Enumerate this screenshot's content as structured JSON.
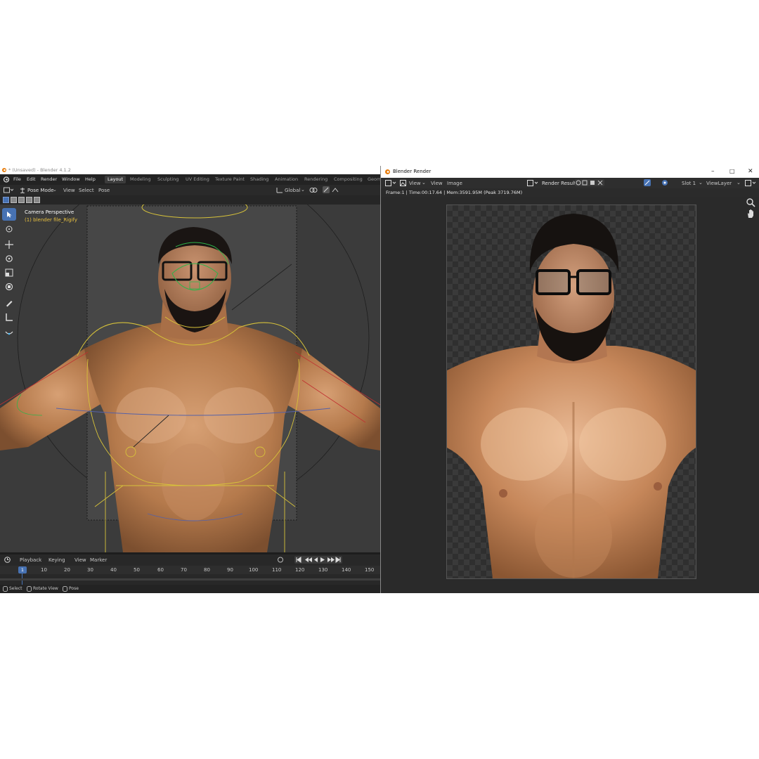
{
  "main_window": {
    "title": "* (Unsaved) - Blender 4.1.2",
    "menu": [
      "File",
      "Edit",
      "Render",
      "Window",
      "Help"
    ],
    "workspaces": [
      "Layout",
      "Modeling",
      "Sculpting",
      "UV Editing",
      "Texture Paint",
      "Shading",
      "Animation",
      "Rendering",
      "Compositing",
      "Geom"
    ],
    "active_workspace": "Layout",
    "header": {
      "mode": "Pose Mode",
      "menus": [
        "View",
        "Select",
        "Pose"
      ],
      "orientation": "Global"
    },
    "viewport": {
      "camera_label": "Camera Perspective",
      "object_label": "(1) blender file_Rigify"
    },
    "tools": [
      "select-box-tool",
      "cursor-tool",
      "move-tool",
      "rotate-tool",
      "scale-tool",
      "transform-tool",
      "annotate-tool",
      "measure-tool",
      "bend-tool"
    ],
    "timeline": {
      "menus": [
        "Playback",
        "Keying",
        "View",
        "Marker"
      ],
      "current_frame": "1",
      "ticks": [
        "10",
        "20",
        "30",
        "40",
        "50",
        "60",
        "70",
        "80",
        "90",
        "100",
        "110",
        "120",
        "130",
        "140",
        "150"
      ]
    },
    "status": [
      "Select",
      "Rotate View",
      "Pose"
    ]
  },
  "render_window": {
    "title": "Blender Render",
    "menus": [
      "View",
      "View",
      "Image"
    ],
    "image_name": "Render Result",
    "slot": "Slot 1",
    "view_layer": "ViewLayer",
    "stats": "Frame:1 | Time:00:17.64 | Mem:3591.95M (Peak 3719.76M)"
  },
  "colors": {
    "accent": "#4772b3",
    "frame_marker": "#4772b3",
    "object_label": "#e8c040",
    "rig_yellow": "#d7c23a",
    "rig_green": "#2fb34a"
  }
}
